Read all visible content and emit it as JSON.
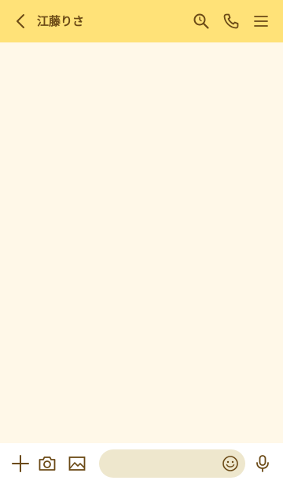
{
  "header": {
    "title": "江藤りさ",
    "icons": [
      "back-chevron-icon",
      "search-icon",
      "phone-icon",
      "menu-icon"
    ]
  },
  "footer": {
    "icons": [
      "plus-icon",
      "camera-icon",
      "image-icon",
      "emoji-icon",
      "mic-icon"
    ],
    "message_placeholder": ""
  },
  "colors": {
    "header_bg": "#FFE278",
    "chat_bg": "#FFF8E8",
    "icon_color": "#6B4A16",
    "input_bg": "#EEE7CD",
    "footer_bg": "#FFFFFF"
  }
}
